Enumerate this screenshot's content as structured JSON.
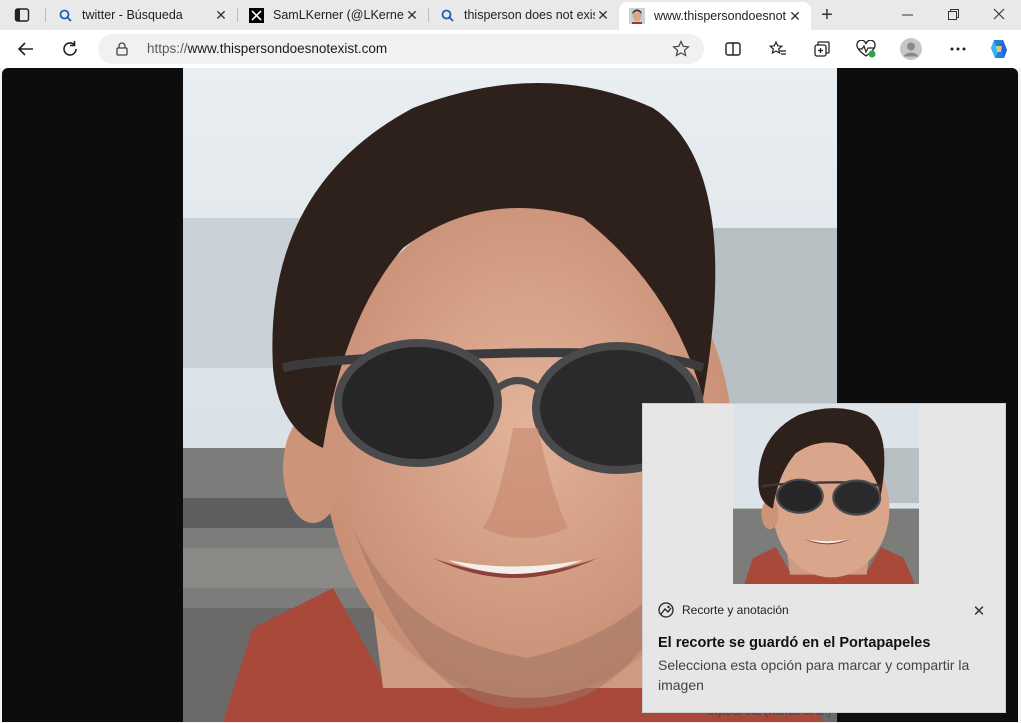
{
  "tabs": [
    {
      "title": "twitter - Búsqueda",
      "icon": "search-icon"
    },
    {
      "title": "SamLKerner (@LKerner5",
      "icon": "x-logo-icon"
    },
    {
      "title": "thisperson does not exis",
      "icon": "search-icon"
    },
    {
      "title": "www.thispersondoesnot",
      "icon": "portrait-favicon-icon"
    }
  ],
  "address": {
    "protocol": "https://",
    "host": "www.thispersondoesnotexist.com"
  },
  "photo_caption": "StyleGAN2 (Karras et al.)",
  "toast": {
    "app_name": "Recorte y anotación",
    "heading": "El recorte se guardó en el Portapapeles",
    "body": "Selecciona esta opción para marcar y compartir la imagen"
  },
  "colors": {
    "copilot": "#1f7fe0",
    "content_bg": "#0d0d0d",
    "toast_bg": "#e6e6e6"
  }
}
